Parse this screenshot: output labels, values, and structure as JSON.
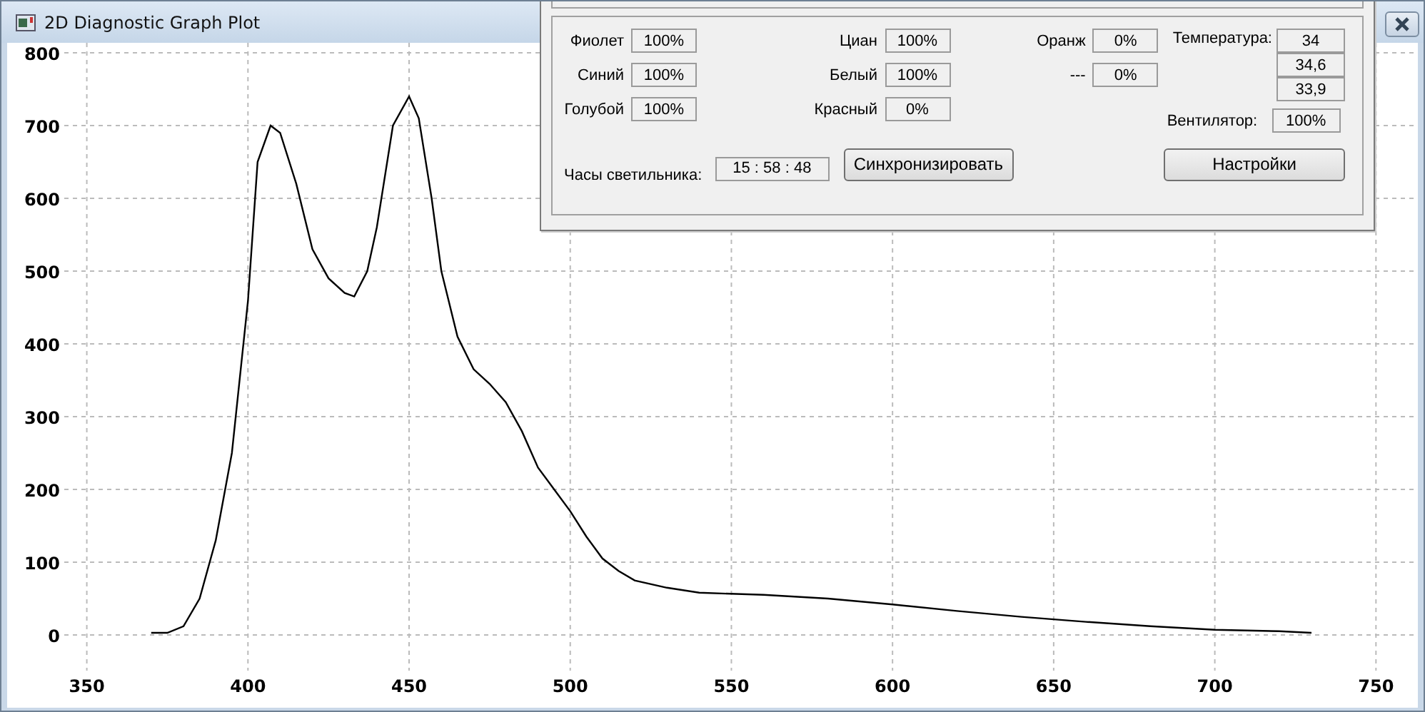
{
  "window": {
    "title": "2D Diagnostic Graph Plot"
  },
  "chart_data": {
    "type": "line",
    "x": [
      370,
      375,
      380,
      385,
      390,
      395,
      400,
      403,
      407,
      410,
      415,
      420,
      425,
      430,
      433,
      437,
      440,
      445,
      450,
      453,
      457,
      460,
      465,
      470,
      475,
      480,
      485,
      490,
      495,
      500,
      505,
      510,
      515,
      520,
      530,
      540,
      560,
      580,
      600,
      620,
      640,
      660,
      680,
      700,
      720,
      730
    ],
    "series": [
      {
        "color": "#000000",
        "values": [
          3,
          3,
          12,
          50,
          130,
          250,
          460,
          650,
          700,
          690,
          620,
          530,
          490,
          470,
          465,
          500,
          560,
          700,
          740,
          710,
          600,
          500,
          410,
          365,
          345,
          320,
          280,
          230,
          200,
          170,
          135,
          105,
          88,
          75,
          65,
          58,
          55,
          50,
          42,
          33,
          25,
          18,
          12,
          7,
          5,
          3
        ]
      }
    ],
    "grid": true,
    "xlim": [
      343,
      763
    ],
    "ylim": [
      0,
      800
    ],
    "xticks": [
      350,
      400,
      450,
      500,
      550,
      600,
      650,
      700,
      750
    ],
    "yticks": [
      0,
      100,
      200,
      300,
      400,
      500,
      600,
      700,
      800
    ]
  },
  "panel": {
    "channel_columns": [
      [
        {
          "label": "Фиолет",
          "value": "100%"
        },
        {
          "label": "Синий",
          "value": "100%"
        },
        {
          "label": "Голубой",
          "value": "100%"
        }
      ],
      [
        {
          "label": "Циан",
          "value": "100%"
        },
        {
          "label": "Белый",
          "value": "100%"
        },
        {
          "label": "Красный",
          "value": "0%"
        }
      ],
      [
        {
          "label": "Оранж",
          "value": "0%"
        },
        {
          "label": "---",
          "value": "0%"
        }
      ]
    ],
    "temperature": {
      "label": "Температура:",
      "values": [
        "34",
        "34,6",
        "33,9"
      ]
    },
    "fan": {
      "label": "Вентилятор:",
      "value": "100%"
    },
    "clock": {
      "label": "Часы светильника:",
      "value": "15 : 58 : 48"
    },
    "sync_button": "Синхронизировать",
    "settings_button": "Настройки"
  }
}
